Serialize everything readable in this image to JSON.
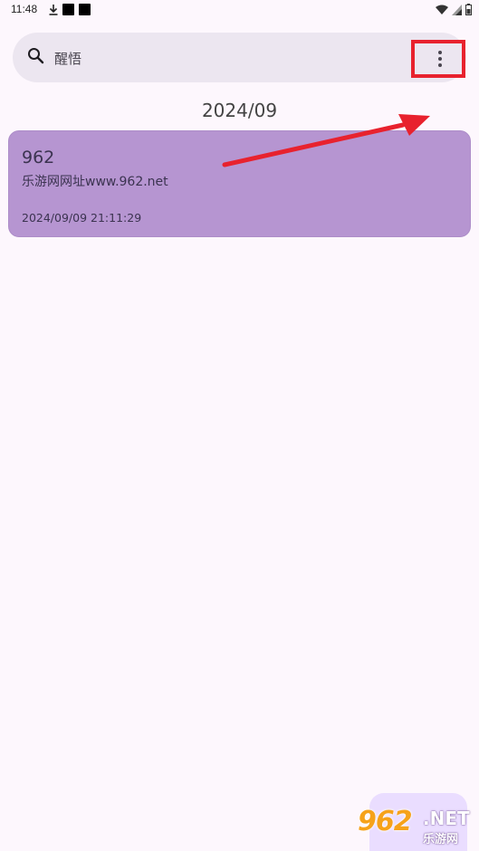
{
  "status_bar": {
    "time": "11:48",
    "icons": [
      "download-icon",
      "notification-square",
      "notification-square",
      "wifi-icon",
      "signal-icon",
      "battery-icon"
    ]
  },
  "search": {
    "text": "醒悟",
    "icon": "search-icon",
    "menu_icon": "more-vert-icon"
  },
  "month_header": "2024/09",
  "notes": [
    {
      "title": "962",
      "body": "乐游网网址www.962.net",
      "date": "2024/09/09 21:11:29"
    }
  ],
  "watermark": {
    "number": "962",
    "net": ".NET",
    "cn": "乐游网"
  },
  "colors": {
    "background": "#fdf7fd",
    "search_bg": "#ece6f0",
    "card_bg": "#b695d1",
    "highlight": "#e8222e",
    "fab_bg": "#eaddff"
  }
}
